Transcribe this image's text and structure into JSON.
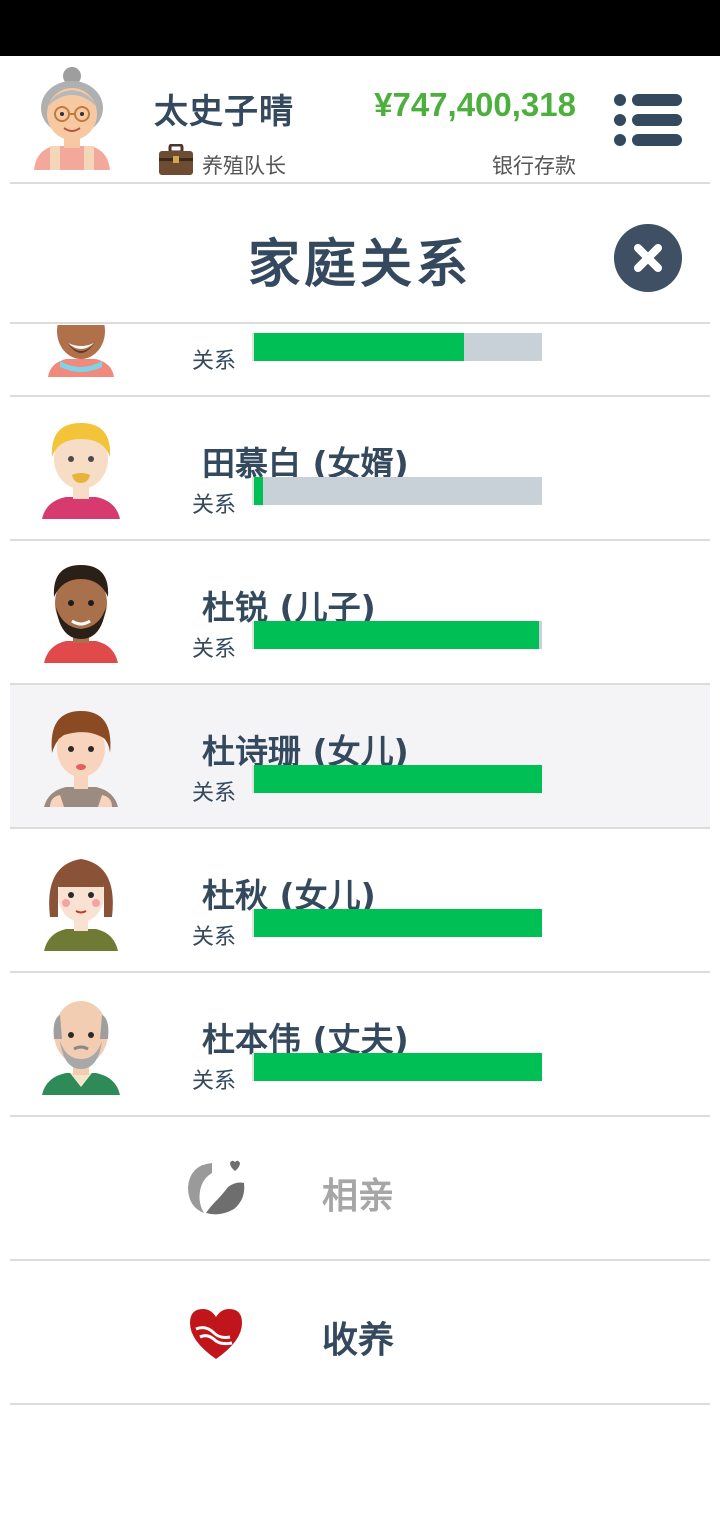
{
  "player": {
    "name": "太史子晴",
    "job_title": "养殖队长",
    "money": "¥747,400,318",
    "bank_label": "银行存款"
  },
  "panel": {
    "title": "家庭关系"
  },
  "family": [
    {
      "name": "",
      "relation_label": "关系",
      "relationship": 0.73
    },
    {
      "name": "田慕白 (女婿)",
      "relation_label": "关系",
      "relationship": 0.03
    },
    {
      "name": "杜锐 (儿子)",
      "relation_label": "关系",
      "relationship": 0.99
    },
    {
      "name": "杜诗珊 (女儿)",
      "relation_label": "关系",
      "relationship": 1.0
    },
    {
      "name": "杜秋 (女儿)",
      "relation_label": "关系",
      "relationship": 1.0
    },
    {
      "name": "杜本伟 (丈夫)",
      "relation_label": "关系",
      "relationship": 1.0
    }
  ],
  "actions": {
    "dating": {
      "label": "相亲",
      "color": "#a6a6a6",
      "icon": "couple-silhouette-icon"
    },
    "adopt": {
      "label": "收养",
      "color": "#34495e",
      "icon": "heart-hands-icon"
    }
  },
  "colors": {
    "bar_fill": "#00c055",
    "bar_track": "#c9d1d8",
    "money": "#4caf3e",
    "text": "#34495e"
  }
}
